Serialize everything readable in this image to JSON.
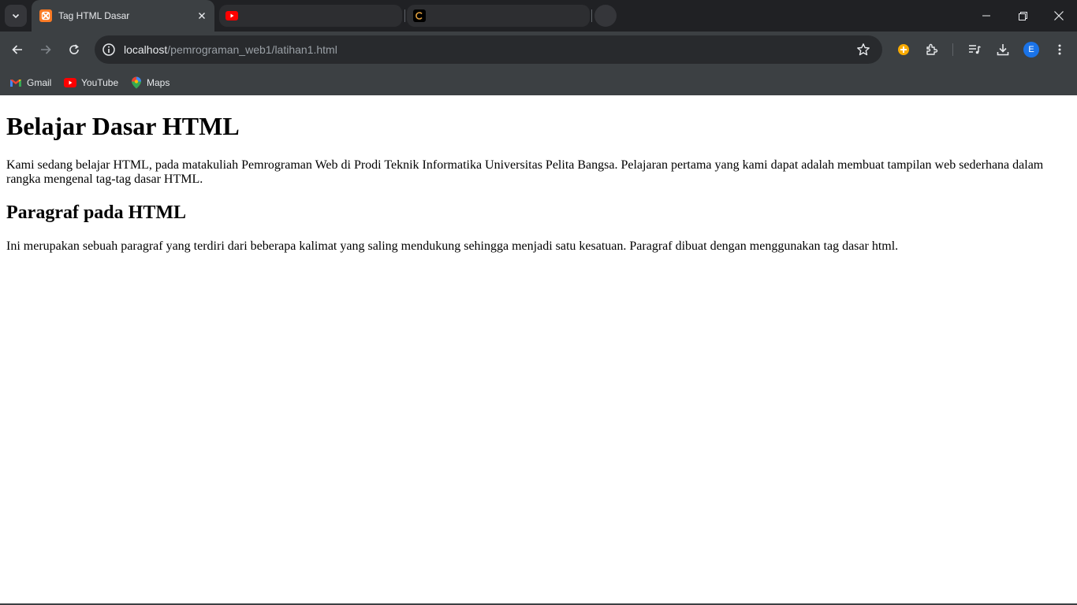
{
  "browser": {
    "tabs": [
      {
        "title": "Tag HTML Dasar",
        "favicon": "xampp-icon",
        "active": true
      },
      {
        "title": "",
        "favicon": "youtube-icon",
        "active": false
      },
      {
        "title": "",
        "favicon": "c-icon",
        "active": false
      }
    ],
    "address": {
      "host": "localhost",
      "path": "/pemrograman_web1/latihan1.html"
    },
    "profile_initial": "E",
    "bookmarks": [
      {
        "label": "Gmail",
        "icon": "gmail-icon"
      },
      {
        "label": "YouTube",
        "icon": "youtube-icon"
      },
      {
        "label": "Maps",
        "icon": "maps-icon"
      }
    ],
    "colors": {
      "tabstrip": "#202124",
      "toolbar": "#3c4043",
      "omnibox": "#282a2d",
      "accent": "#1a73e8"
    }
  },
  "page": {
    "heading": "Belajar Dasar HTML",
    "intro": "Kami sedang belajar HTML, pada matakuliah Pemrograman Web di Prodi Teknik Informatika Universitas Pelita Bangsa. Pelajaran pertama yang kami dapat adalah membuat tampilan web sederhana dalam rangka mengenal tag-tag dasar HTML.",
    "subheading": "Paragraf pada HTML",
    "paragraph": "Ini merupakan sebuah paragraf yang terdiri dari beberapa kalimat yang saling mendukung sehingga menjadi satu kesatuan. Paragraf dibuat dengan menggunakan tag dasar html."
  }
}
